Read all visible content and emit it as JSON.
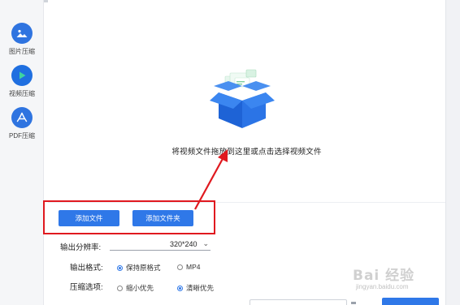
{
  "sidebar": {
    "items": [
      {
        "label": "图片压缩",
        "icon": "image-icon"
      },
      {
        "label": "视频压缩",
        "icon": "play-icon"
      },
      {
        "label": "PDF压缩",
        "icon": "pdf-icon"
      }
    ]
  },
  "drop_zone": {
    "text": "将视频文件拖放到这里或点击选择视频文件",
    "icon": "open-box-icon"
  },
  "actions": {
    "add_file": "添加文件",
    "add_folder": "添加文件夹"
  },
  "settings": {
    "resolution_label": "输出分辨率:",
    "resolution_value": "320*240",
    "format_label": "输出格式:",
    "format_options": [
      "保持原格式",
      "MP4"
    ],
    "format_selected": "保持原格式",
    "compress_label": "压缩选项:",
    "compress_options": [
      "缩小优先",
      "清晰优先"
    ],
    "compress_selected": "清晰优先"
  },
  "watermark": {
    "brand": "Bai 经验",
    "url": "jingyan.baidu.com"
  },
  "colors": {
    "accent": "#2f78e8",
    "highlight_border": "#e0191f",
    "arrow": "#e0191f",
    "sidebar_bg": "#f5f6f8"
  }
}
